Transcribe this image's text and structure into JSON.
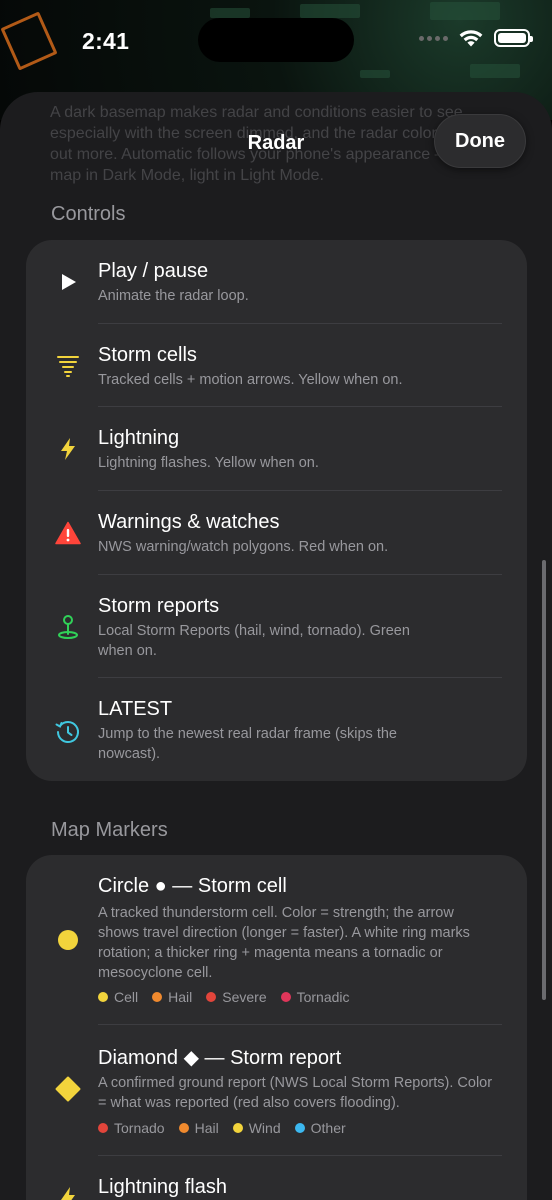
{
  "status": {
    "time": "2:41"
  },
  "nav": {
    "ghost_text": "A dark basemap makes radar and conditions easier to see, especially with the screen dimmed, and the radar colors stand out more. Automatic follows your phone's appearance — dark map in Dark Mode, light in Light Mode.",
    "title": "Radar",
    "done_label": "Done"
  },
  "controls": {
    "header": "Controls",
    "items": [
      {
        "title": "Play / pause",
        "subtitle": "Animate the radar loop.",
        "icon": "play-icon"
      },
      {
        "title": "Storm cells",
        "subtitle": "Tracked cells + motion arrows. Yellow when on.",
        "icon": "tornado-icon"
      },
      {
        "title": "Lightning",
        "subtitle": "Lightning flashes. Yellow when on.",
        "icon": "bolt-icon"
      },
      {
        "title": "Warnings & watches",
        "subtitle": "NWS warning/watch polygons. Red when on.",
        "icon": "warning-triangle-icon"
      },
      {
        "title": "Storm reports",
        "subtitle": "Local Storm Reports (hail, wind, tornado). Green when on.",
        "icon": "map-pin-icon"
      },
      {
        "title": "LATEST",
        "subtitle": "Jump to the newest real radar frame (skips the nowcast).",
        "icon": "clock-history-icon"
      }
    ]
  },
  "markers": {
    "header": "Map Markers",
    "items": [
      {
        "title": "Circle ● — Storm cell",
        "subtitle": "A tracked thunderstorm cell. Color = strength; the arrow shows travel direction (longer = faster). A white ring marks rotation; a thicker ring + magenta means a tornadic or mesocyclone cell.",
        "icon": "circle-marker-icon",
        "legend": [
          {
            "label": "Cell",
            "color": "#f2d43c"
          },
          {
            "label": "Hail",
            "color": "#f08a2e"
          },
          {
            "label": "Severe",
            "color": "#e2453b"
          },
          {
            "label": "Tornadic",
            "color": "#e0365a"
          }
        ]
      },
      {
        "title": "Diamond ◆ — Storm report",
        "subtitle": "A confirmed ground report (NWS Local Storm Reports). Color = what was reported (red also covers flooding).",
        "icon": "diamond-marker-icon",
        "legend": [
          {
            "label": "Tornado",
            "color": "#e2453b"
          },
          {
            "label": "Hail",
            "color": "#f08a2e"
          },
          {
            "label": "Wind",
            "color": "#f2d43c"
          },
          {
            "label": "Other",
            "color": "#3cb8f0"
          }
        ]
      },
      {
        "title": "Lightning flash",
        "icon": "bolt-icon"
      }
    ]
  },
  "colors": {
    "yellow": "#f2d43c",
    "red": "#ff453a",
    "green": "#30d158",
    "blue": "#40c8e0"
  }
}
